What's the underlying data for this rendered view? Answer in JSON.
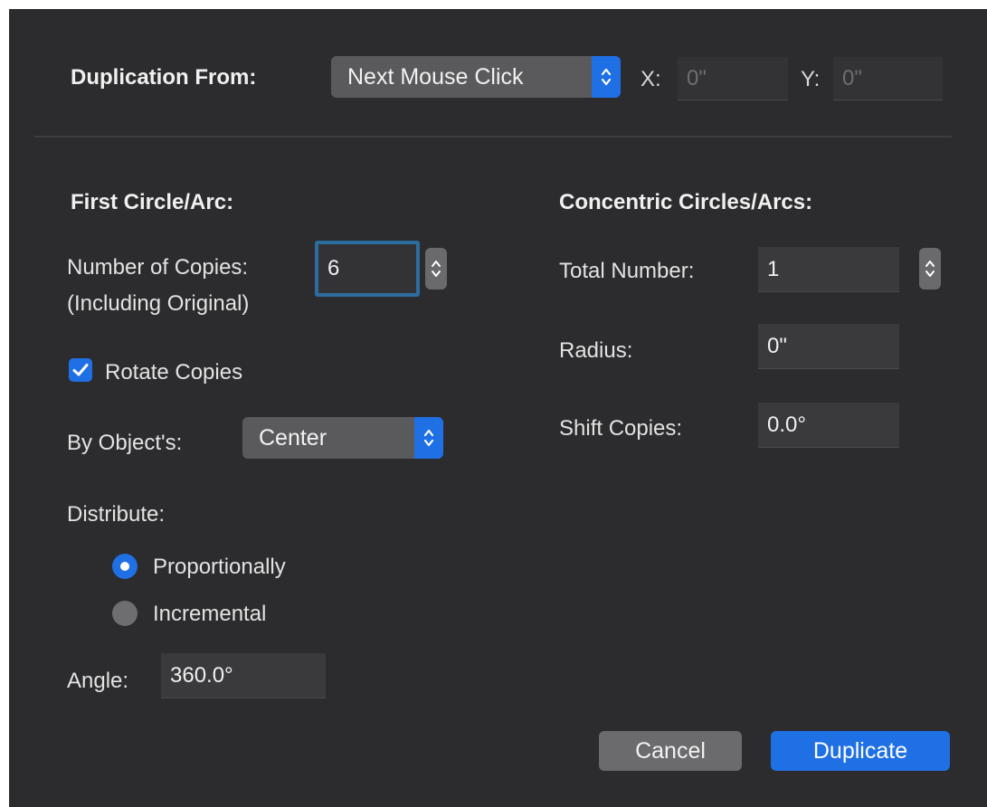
{
  "header": {
    "duplication_from_label": "Duplication From:",
    "duplication_from_value": "Next Mouse Click",
    "x_label": "X:",
    "x_value": "0\"",
    "y_label": "Y:",
    "y_value": "0\""
  },
  "first": {
    "heading": "First Circle/Arc:",
    "copies_label": "Number of Copies:",
    "copies_sublabel": "(Including Original)",
    "copies_value": "6",
    "rotate_label": "Rotate Copies",
    "rotate_checked": true,
    "by_object_label": "By Object's:",
    "by_object_value": "Center",
    "distribute_label": "Distribute:",
    "distribute_options": [
      {
        "label": "Proportionally",
        "selected": true
      },
      {
        "label": "Incremental",
        "selected": false
      }
    ],
    "angle_label": "Angle:",
    "angle_value": "360.0°"
  },
  "concentric": {
    "heading": "Concentric Circles/Arcs:",
    "total_label": "Total Number:",
    "total_value": "1",
    "radius_label": "Radius:",
    "radius_value": "0\"",
    "shift_label": "Shift Copies:",
    "shift_value": "0.0°"
  },
  "buttons": {
    "cancel": "Cancel",
    "duplicate": "Duplicate"
  },
  "colors": {
    "background": "#2c2c2e",
    "accent": "#1f6fe5",
    "focus_ring": "#2d6d9e"
  }
}
